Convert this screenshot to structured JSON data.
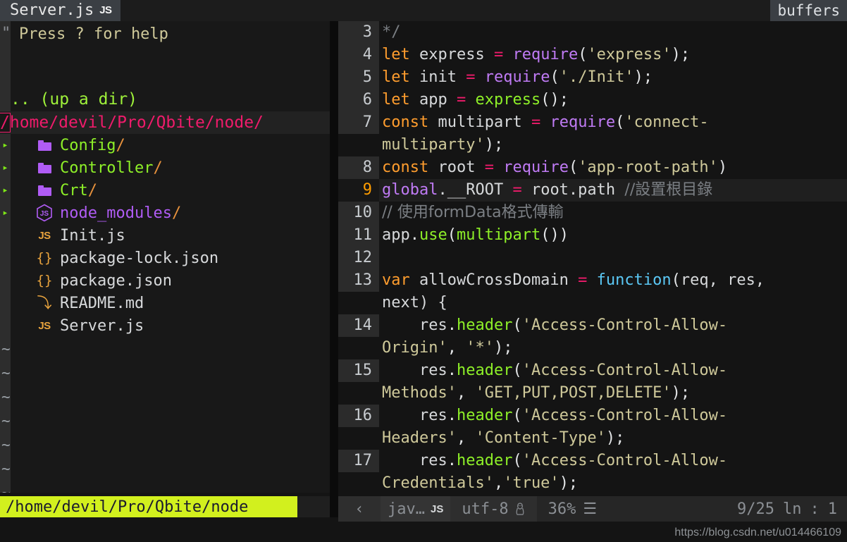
{
  "tabbar": {
    "active_tab": "Server.js",
    "active_tab_badge": "JS",
    "buffers_label": "buffers"
  },
  "tree": {
    "help_marker": "\"",
    "help_text": "Press ? for help",
    "up_dir": ".. (up a dir)",
    "root_path_cursor": "/",
    "root_path_rest": "home/devil/Pro/Qbite/node/",
    "items": [
      {
        "expander": "▸",
        "icon": "folder-icon",
        "name": "Config",
        "suffix": "/",
        "kind": "dir"
      },
      {
        "expander": "▸",
        "icon": "folder-icon",
        "name": "Controller",
        "suffix": "/",
        "kind": "dir"
      },
      {
        "expander": "▸",
        "icon": "folder-icon",
        "name": "Crt",
        "suffix": "/",
        "kind": "dir"
      },
      {
        "expander": "▸",
        "icon": "nodejs-hex-icon",
        "name": "node_modules",
        "suffix": "/",
        "kind": "node"
      },
      {
        "expander": "",
        "icon": "js-file-icon",
        "name": "Init.js",
        "suffix": "",
        "kind": "file"
      },
      {
        "expander": "",
        "icon": "json-file-icon",
        "name": "package-lock.json",
        "suffix": "",
        "kind": "file"
      },
      {
        "expander": "",
        "icon": "json-file-icon",
        "name": "package.json",
        "suffix": "",
        "kind": "file"
      },
      {
        "expander": "",
        "icon": "markdown-file-icon",
        "name": "README.md",
        "suffix": "",
        "kind": "file"
      },
      {
        "expander": "",
        "icon": "js-file-icon",
        "name": "Server.js",
        "suffix": "",
        "kind": "file"
      }
    ],
    "empty_markers": [
      "~",
      "~",
      "~",
      "~",
      "~",
      "~",
      "~",
      "~"
    ],
    "path_status": "/home/devil/Pro/Qbite/node"
  },
  "editor": {
    "lines": [
      {
        "num": "3",
        "current": false
      },
      {
        "num": "4",
        "current": false
      },
      {
        "num": "5",
        "current": false
      },
      {
        "num": "6",
        "current": false
      },
      {
        "num": "7",
        "current": false
      },
      {
        "num": "8",
        "current": false
      },
      {
        "num": "9",
        "current": true
      },
      {
        "num": "10",
        "current": false
      },
      {
        "num": "11",
        "current": false
      },
      {
        "num": "12",
        "current": false
      },
      {
        "num": "13",
        "current": false
      },
      {
        "num": "14",
        "current": false
      },
      {
        "num": "15",
        "current": false
      },
      {
        "num": "16",
        "current": false
      },
      {
        "num": "17",
        "current": false
      }
    ],
    "text": {
      "l3": "*/",
      "l4": "let express = require('express');",
      "l5": "let init = require('./Init');",
      "l6": "let app = express();",
      "l7": "const multipart = require('connect-multiparty');",
      "l8": "const root = require('app-root-path')",
      "l9": "global.__ROOT = root.path //設置根目錄",
      "l10": "// 使用formData格式傳輸",
      "l11": "app.use(multipart())",
      "l12": "",
      "l13": "var allowCrossDomain = function(req, res, next) {",
      "l14": "    res.header('Access-Control-Allow-Origin', '*');",
      "l15": "    res.header('Access-Control-Allow-Methods', 'GET,PUT,POST,DELETE');",
      "l16": "    res.header('Access-Control-Allow-Headers', 'Content-Type');",
      "l17": "    res.header('Access-Control-Allow-Credentials','true');"
    },
    "tok": {
      "let": "let",
      "const": "const",
      "var": "var",
      "eq": "=",
      "require": "require",
      "global": "global",
      "express_id": "express",
      "init_id": "init",
      "app_id": "app",
      "multipart_id": "multipart",
      "root_id": "root",
      "s_express": "'express'",
      "s_init": "'./Init'",
      "s_connect": "'connect-",
      "s_multiparty": "multiparty'",
      "s_approot": "'app-root-path'",
      "express_call": "express",
      "use_call": "use",
      "header_call": "header",
      "dot_root": ".__ROOT",
      "root_path": " root.path ",
      "cmt9": "//設置根目錄",
      "cmt10": "// 使用formData格式傳輸",
      "allowCross": "allowCrossDomain",
      "function": "function",
      "args": "req, res, ",
      "args2": "next) {",
      "res": "res",
      "header": "header",
      "s_origin_a": "'Access-Control-Allow-",
      "s_origin_b": "Origin'",
      "s_star": "'*'",
      "s_methods_b": "Methods'",
      "s_methodlist": "'GET,PUT,POST,DELETE'",
      "s_headers_b": "Headers'",
      "s_ctype": "'Content-Type'",
      "s_creds_b": "Credentials'",
      "s_true": "'true'",
      "app_use": "app",
      "multipart_call": "multipart"
    }
  },
  "statusbar": {
    "back_arrow": "‹",
    "filetype": "jav…",
    "filetype_badge": "JS",
    "encoding": "utf-8",
    "os_icon": "linux-penguin-icon",
    "percent": "36%",
    "lines_icon": "☰",
    "position": "9/25",
    "ln_label": "ln",
    "colon": ":",
    "column": "1"
  },
  "watermark": {
    "text": "https://blog.csdn.net/u014466109"
  },
  "colors": {
    "accent_green": "#8ef028",
    "accent_purple": "#b05cf5",
    "accent_pink": "#ef1b6b",
    "accent_orange": "#ff9d2e",
    "path_bar_bg": "#d2f01e",
    "string": "#cfc99a",
    "function_blue": "#5bc8f5"
  }
}
